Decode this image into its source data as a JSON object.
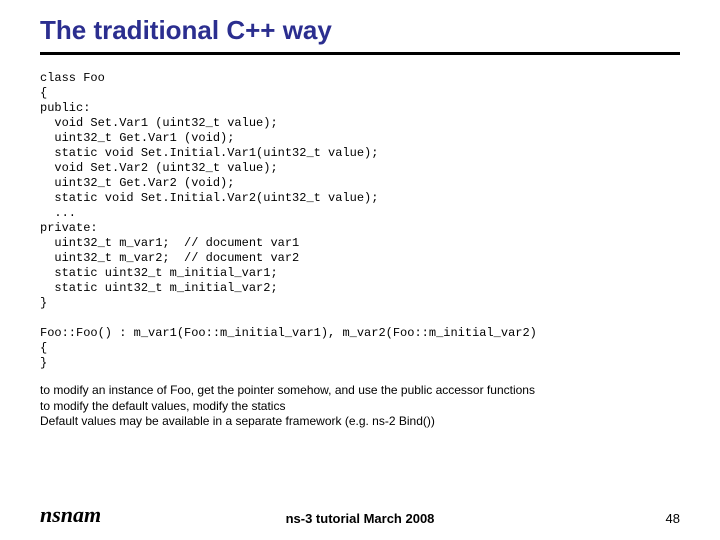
{
  "title": "The traditional C++ way",
  "code": "class Foo\n{\npublic:\n  void Set.Var1 (uint32_t value);\n  uint32_t Get.Var1 (void);\n  static void Set.Initial.Var1(uint32_t value);\n  void Set.Var2 (uint32_t value);\n  uint32_t Get.Var2 (void);\n  static void Set.Initial.Var2(uint32_t value);\n  ...\nprivate:\n  uint32_t m_var1;  // document var1\n  uint32_t m_var2;  // document var2\n  static uint32_t m_initial_var1;\n  static uint32_t m_initial_var2;\n}\n\nFoo::Foo() : m_var1(Foo::m_initial_var1), m_var2(Foo::m_initial_var2)\n{\n}",
  "note_lines": {
    "l1": "to modify an instance of Foo, get the pointer somehow, and use the public accessor functions",
    "l2": "to modify the default values, modify the statics",
    "l3": "Default values may be available in a separate framework (e.g. ns-2 Bind())"
  },
  "footer": {
    "logo": "nsnam",
    "center": "ns-3 tutorial March 2008",
    "page": "48"
  }
}
